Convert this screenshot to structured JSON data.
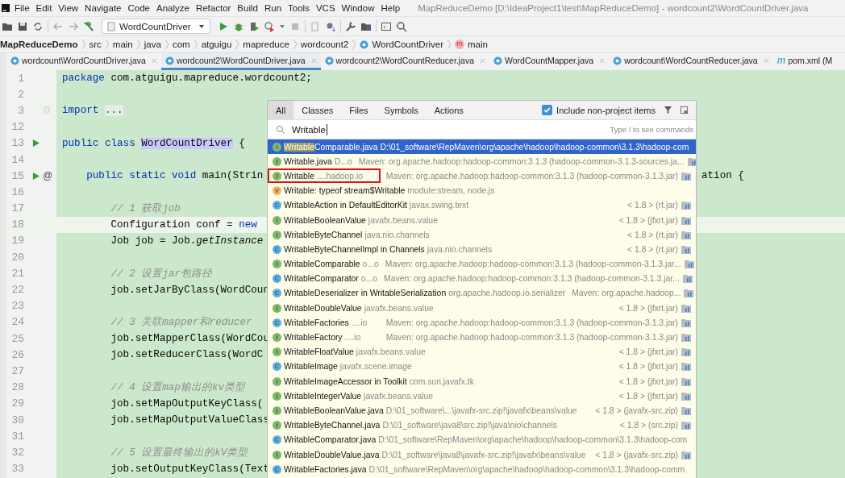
{
  "menu": [
    "File",
    "Edit",
    "View",
    "Navigate",
    "Code",
    "Analyze",
    "Refactor",
    "Build",
    "Run",
    "Tools",
    "VCS",
    "Window",
    "Help"
  ],
  "window": {
    "title": "MapReduceDemo [D:\\IdeaProject1\\test\\MapReduceDemo] - wordcount2\\WordCountDriver.java"
  },
  "toolbar": {
    "run_config": "WordCountDriver"
  },
  "breadcrumb": [
    {
      "label": "MapReduceDemo",
      "kind": "project"
    },
    {
      "label": "src",
      "kind": "dir"
    },
    {
      "label": "main",
      "kind": "dir"
    },
    {
      "label": "java",
      "kind": "dir"
    },
    {
      "label": "com",
      "kind": "dir"
    },
    {
      "label": "atguigu",
      "kind": "dir"
    },
    {
      "label": "mapreduce",
      "kind": "dir"
    },
    {
      "label": "wordcount2",
      "kind": "dir"
    },
    {
      "label": "WordCountDriver",
      "kind": "class"
    },
    {
      "label": "main",
      "kind": "method",
      "icon": "m"
    }
  ],
  "tabs": [
    {
      "label": "wordcount\\WordCountDriver.java",
      "kind": "class",
      "selected": false
    },
    {
      "label": "wordcount2\\WordCountDriver.java",
      "kind": "class",
      "selected": true
    },
    {
      "label": "wordcount2\\WordCountReducer.java",
      "kind": "class",
      "selected": false
    },
    {
      "label": "WordCountMapper.java",
      "kind": "class",
      "selected": false
    },
    {
      "label": "wordcount\\WordCountReducer.java",
      "kind": "class",
      "selected": false
    },
    {
      "label": "pom.xml (M",
      "kind": "maven",
      "icon": "m",
      "selected": false
    }
  ],
  "code": [
    {
      "n": "1",
      "tokens": [
        {
          "t": "package",
          "kind": "keyword"
        },
        {
          "t": " com.atguigu.mapreduce.wordcount2;",
          "kind": "plain"
        }
      ]
    },
    {
      "n": "2"
    },
    {
      "n": "3",
      "kind": "fold",
      "tokens": [
        {
          "t": "import",
          "kind": "keyword"
        },
        {
          "t": "...",
          "kind": "folded"
        }
      ]
    },
    {
      "n": "12"
    },
    {
      "n": "13",
      "kind": "run",
      "tokens": [
        {
          "t": "public class",
          "kind": "keyword"
        },
        {
          "t": "WordCountDriver",
          "kind": "highlight"
        },
        {
          "t": " {",
          "kind": "plain"
        }
      ]
    },
    {
      "n": "14"
    },
    {
      "n": "15",
      "kind": "run-override",
      "marker": "@",
      "tokens": [
        {
          "t": "    public static void",
          "kind": "keyword"
        },
        {
          "t": " main(Strin",
          "kind": "plain"
        }
      ],
      "tail": "ation {"
    },
    {
      "n": "16"
    },
    {
      "n": "17",
      "tokens": [
        {
          "t": "        // 1 获取job",
          "kind": "comment"
        }
      ]
    },
    {
      "n": "18",
      "current": true,
      "tokens": [
        {
          "t": "        Configuration conf = ",
          "kind": "plain"
        },
        {
          "t": "new",
          "kind": "keyword"
        }
      ]
    },
    {
      "n": "19",
      "tokens": [
        {
          "t": "        Job job = Job.",
          "kind": "plain"
        },
        {
          "t": "getInstance",
          "kind": "italic"
        }
      ]
    },
    {
      "n": "20"
    },
    {
      "n": "21",
      "tokens": [
        {
          "t": "        // 2 设置jar包路径",
          "kind": "comment"
        }
      ]
    },
    {
      "n": "22",
      "tokens": [
        {
          "t": "        job.setJarByClass(WordCoun",
          "kind": "plain"
        }
      ]
    },
    {
      "n": "23"
    },
    {
      "n": "24",
      "tokens": [
        {
          "t": "        // 3 关联mapper和reducer",
          "kind": "comment"
        }
      ]
    },
    {
      "n": "25",
      "tokens": [
        {
          "t": "        job.setMapperClass(WordCou",
          "kind": "plain"
        }
      ]
    },
    {
      "n": "26",
      "tokens": [
        {
          "t": "        job.setReducerClass(WordC",
          "kind": "plain"
        }
      ]
    },
    {
      "n": "27"
    },
    {
      "n": "28",
      "tokens": [
        {
          "t": "        // 4 设置map输出的kv类型",
          "kind": "comment"
        }
      ]
    },
    {
      "n": "29",
      "tokens": [
        {
          "t": "        job.setMapOutputKeyClass(",
          "kind": "plain"
        }
      ]
    },
    {
      "n": "30",
      "tokens": [
        {
          "t": "        job.setMapOutputValueClass",
          "kind": "plain"
        }
      ]
    },
    {
      "n": "31"
    },
    {
      "n": "32",
      "tokens": [
        {
          "t": "        // 5 设置最终输出的kV类型",
          "kind": "comment"
        }
      ]
    },
    {
      "n": "33",
      "tokens": [
        {
          "t": "        job.setOutputKeyClass(Text",
          "kind": "plain"
        }
      ]
    }
  ],
  "popup": {
    "tabs": [
      {
        "label": "All",
        "selected": true
      },
      {
        "label": "Classes",
        "selected": false
      },
      {
        "label": "Files",
        "selected": false
      },
      {
        "label": "Symbols",
        "selected": false
      },
      {
        "label": "Actions",
        "selected": false
      }
    ],
    "include_non_project": {
      "label": "Include non-project items",
      "checked": true
    },
    "search": {
      "value": "Writable",
      "hint": "Type / to see commands"
    },
    "results": [
      {
        "kind": "interface",
        "icon": "I",
        "selected": true,
        "match": "Writable",
        "name": "Comparable.java",
        "detail": "D:\\01_software\\RepMaven\\org\\apache\\hadoop\\hadoop-common\\3.1.3\\hadoop-com"
      },
      {
        "kind": "interface",
        "icon": "I",
        "selected": false,
        "name": "Writable.java",
        "detail": "D...o",
        "location": "Maven: org.apache.hadoop:hadoop-common:3.1.3 (hadoop-common-3.1.3-sources.ja...",
        "library": true
      },
      {
        "kind": "interface",
        "icon": "I",
        "selected": false,
        "boxed": true,
        "name": "Writable",
        "detail": "....hadoop.io",
        "location": "Maven: org.apache.hadoop:hadoop-common:3.1.3 (hadoop-common-3.1.3.jar)",
        "library": true
      },
      {
        "kind": "variable",
        "icon": "V",
        "selected": false,
        "name": "Writable: typeof stream$Writable",
        "detail": "module:stream, node.js"
      },
      {
        "kind": "class",
        "icon": "C",
        "selected": false,
        "name": "WritableAction in DefaultEditorKit",
        "detail": "javax.swing.text",
        "location": "< 1.8 > (rt.jar)",
        "library": true
      },
      {
        "kind": "interface",
        "icon": "I",
        "selected": false,
        "name": "WritableBooleanValue",
        "detail": "javafx.beans.value",
        "location": "< 1.8 > (jfxrt.jar)",
        "library": true
      },
      {
        "kind": "interface",
        "icon": "I",
        "selected": false,
        "name": "WritableByteChannel",
        "detail": "java.nio.channels",
        "location": "< 1.8 > (rt.jar)",
        "library": true
      },
      {
        "kind": "class",
        "icon": "C",
        "selected": false,
        "name": "WritableByteChannelImpl in Channels",
        "detail": "java.nio.channels",
        "location": "< 1.8 > (rt.jar)",
        "library": true
      },
      {
        "kind": "interface",
        "icon": "I",
        "selected": false,
        "name": "WritableComparable",
        "detail": "o...o",
        "location": "Maven: org.apache.hadoop:hadoop-common:3.1.3 (hadoop-common-3.1.3.jar...",
        "library": true
      },
      {
        "kind": "class",
        "icon": "C",
        "selected": false,
        "name": "WritableComparator",
        "detail": "o...o",
        "location": "Maven: org.apache.hadoop:hadoop-common:3.1.3 (hadoop-common-3.1.3.jar...",
        "library": true
      },
      {
        "kind": "class",
        "icon": "C",
        "selected": false,
        "name": "WritableDeserializer in WritableSerialization",
        "detail": "org.apache.hadoop.io.serializer",
        "location": "Maven: org.apache.hadoop...",
        "library": true
      },
      {
        "kind": "interface",
        "icon": "I",
        "selected": false,
        "name": "WritableDoubleValue",
        "detail": "javafx.beans.value",
        "location": "< 1.8 > (jfxrt.jar)",
        "library": true
      },
      {
        "kind": "class",
        "icon": "C",
        "selected": false,
        "name": "WritableFactories",
        "detail": "....io",
        "location": "Maven: org.apache.hadoop:hadoop-common:3.1.3 (hadoop-common-3.1.3.jar)",
        "library": true
      },
      {
        "kind": "interface",
        "icon": "I",
        "selected": false,
        "name": "WritableFactory",
        "detail": "....io",
        "location": "Maven: org.apache.hadoop:hadoop-common:3.1.3 (hadoop-common-3.1.3.jar)",
        "library": true
      },
      {
        "kind": "interface",
        "icon": "I",
        "selected": false,
        "name": "WritableFloatValue",
        "detail": "javafx.beans.value",
        "location": "< 1.8 > (jfxrt.jar)",
        "library": true
      },
      {
        "kind": "class",
        "icon": "C",
        "selected": false,
        "name": "WritableImage",
        "detail": "javafx.scene.image",
        "location": "< 1.8 > (jfxrt.jar)",
        "library": true
      },
      {
        "kind": "interface",
        "icon": "I",
        "selected": false,
        "name": "WritableImageAccessor in Toolkit",
        "detail": "com.sun.javafx.tk",
        "location": "< 1.8 > (jfxrt.jar)",
        "library": true
      },
      {
        "kind": "interface",
        "icon": "I",
        "selected": false,
        "name": "WritableIntegerValue",
        "detail": "javafx.beans.value",
        "location": "< 1.8 > (jfxrt.jar)",
        "library": true
      },
      {
        "kind": "interface",
        "icon": "I",
        "selected": false,
        "name": "WritableBooleanValue.java",
        "detail": "D:\\01_software\\...\\javafx-src.zip!\\javafx\\beans\\value",
        "location": "< 1.8 > (javafx-src.zip)",
        "library": true
      },
      {
        "kind": "interface",
        "icon": "I",
        "selected": false,
        "name": "WritableByteChannel.java",
        "detail": "D:\\01_software\\java8\\src.zip!\\java\\nio\\channels",
        "location": "< 1.8 > (src.zip)",
        "library": true
      },
      {
        "kind": "class",
        "icon": "C",
        "selected": false,
        "name": "WritableComparator.java",
        "detail": "D:\\01_software\\RepMaven\\org\\apache\\hadoop\\hadoop-common\\3.1.3\\hadoop-com"
      },
      {
        "kind": "interface",
        "icon": "I",
        "selected": false,
        "name": "WritableDoubleValue.java",
        "detail": "D:\\01_software\\java8\\javafx-src.zip!\\javafx\\beans\\value",
        "location": "< 1.8 > (javafx-src.zip)",
        "library": true
      },
      {
        "kind": "class",
        "icon": "C",
        "selected": false,
        "name": "WritableFactories.java",
        "detail": "D:\\01_software\\RepMaven\\org\\apache\\hadoop\\hadoop-common\\3.1.3\\hadoop-comm"
      }
    ]
  }
}
